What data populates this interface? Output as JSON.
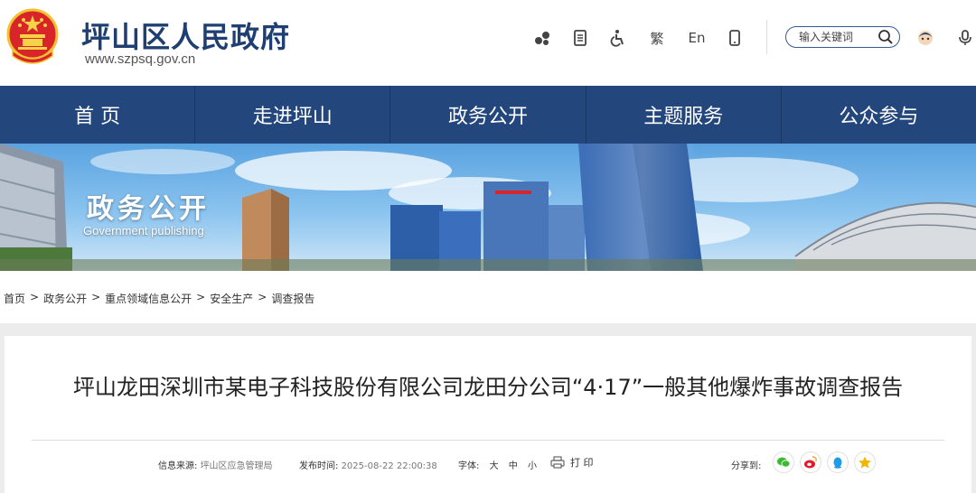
{
  "header": {
    "site_name": "坪山区人民政府",
    "site_url": "www.szpsq.gov.cn",
    "tools": {
      "traditional_label": "繁",
      "english_label": "En"
    },
    "search": {
      "placeholder": "输入关键词"
    }
  },
  "nav": {
    "items": [
      {
        "label": "首 页"
      },
      {
        "label": "走进坪山"
      },
      {
        "label": "政务公开"
      },
      {
        "label": "主题服务"
      },
      {
        "label": "公众参与"
      }
    ]
  },
  "banner": {
    "title": "政务公开",
    "subtitle": "Government publishing"
  },
  "breadcrumb": {
    "items": [
      "首页",
      "政务公开",
      "重点领域信息公开",
      "安全生产",
      "调查报告"
    ],
    "separator": ">"
  },
  "article": {
    "title": "坪山龙田深圳市某电子科技股份有限公司龙田分公司“4·17”一般其他爆炸事故调查报告",
    "meta": {
      "source_label": "信息来源:",
      "source_value": "坪山区应急管理局",
      "date_label": "发布时间:",
      "date_value": "2025-08-22 22:00:38",
      "font_label": "字体:",
      "font_large": "大",
      "font_medium": "中",
      "font_small": "小",
      "print_label": "打 印",
      "share_label": "分享到:"
    }
  },
  "colors": {
    "brand_blue": "#23467c",
    "title_blue": "#1f3f72"
  }
}
